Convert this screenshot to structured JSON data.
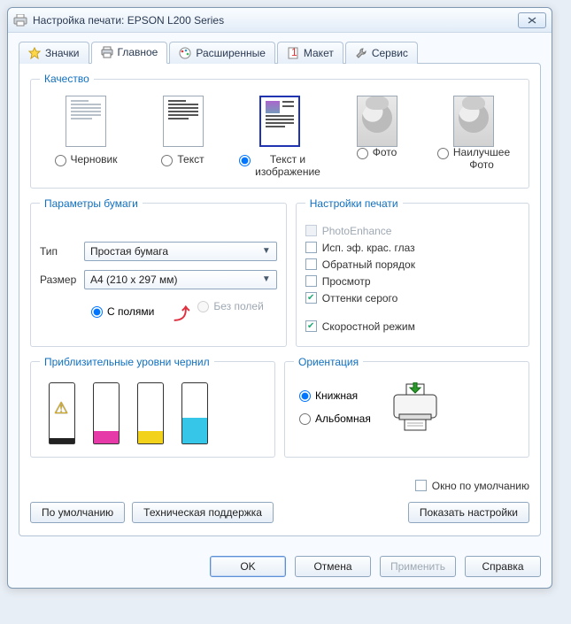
{
  "window": {
    "title": "Настройка печати: EPSON L200 Series"
  },
  "tabs": {
    "icons": "Значки",
    "main": "Главное",
    "advanced": "Расширенные",
    "layout": "Макет",
    "service": "Сервис"
  },
  "quality": {
    "legend": "Качество",
    "draft": "Черновик",
    "text": "Текст",
    "text_image_l1": "Текст и",
    "text_image_l2": "изображение",
    "photo": "Фото",
    "best_l1": "Наилучшее",
    "best_l2": "Фото"
  },
  "paper": {
    "legend": "Параметры бумаги",
    "type_label": "Тип",
    "type_value": "Простая бумага",
    "size_label": "Размер",
    "size_value": "A4 (210 x 297 мм)",
    "with_margins": "С полями",
    "borderless": "Без полей"
  },
  "print_settings": {
    "legend": "Настройки печати",
    "photoenhance": "PhotoEnhance",
    "redeye": "Исп. эф. крас. глаз",
    "reverse": "Обратный порядок",
    "preview": "Просмотр",
    "grayscale": "Оттенки серого",
    "fast": "Скоростной режим"
  },
  "inks": {
    "legend": "Приблизительные уровни чернил"
  },
  "orientation": {
    "legend": "Ориентация",
    "portrait": "Книжная",
    "landscape": "Альбомная"
  },
  "footer": {
    "default_window": "Окно по умолчанию",
    "defaults": "По умолчанию",
    "support": "Техническая поддержка",
    "show_settings": "Показать настройки"
  },
  "dialog": {
    "ok": "OK",
    "cancel": "Отмена",
    "apply": "Применить",
    "help": "Справка"
  }
}
